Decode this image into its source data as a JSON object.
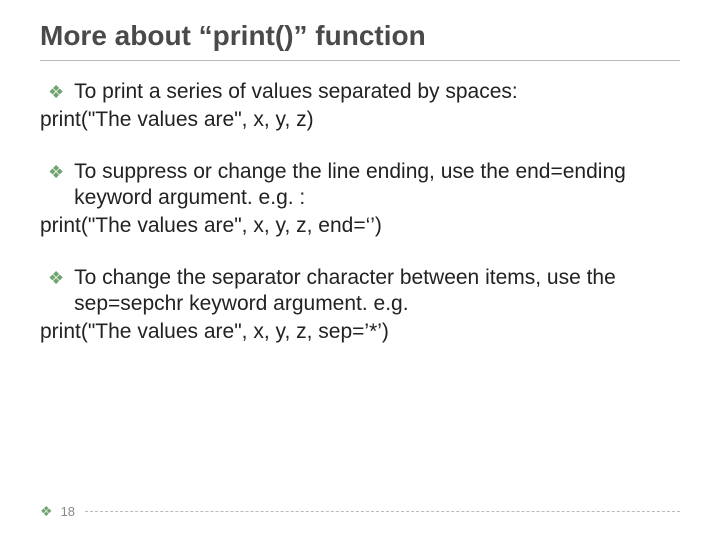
{
  "title": "More about “print()” function",
  "items": [
    {
      "text": "To print a series of values separated by spaces:",
      "code": "print(\"The values are\", x, y, z)"
    },
    {
      "text": "To suppress or change the line ending, use the end=ending keyword argument. e.g. :",
      "code": "print(\"The values are\", x, y, z, end=‘’)"
    },
    {
      "text": "To change the separator character between items, use the sep=sepchr keyword argument. e.g.",
      "code": "print(\"The values are\", x, y, z, sep=’*’)"
    }
  ],
  "page_number": "18"
}
